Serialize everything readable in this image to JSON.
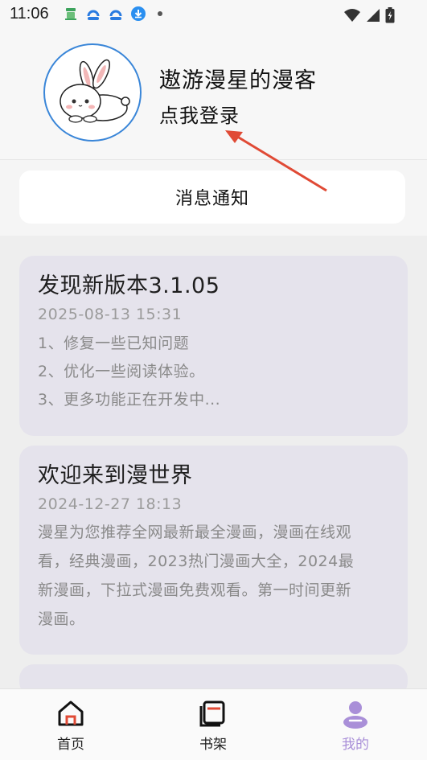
{
  "status_bar": {
    "time": "11:06",
    "icons": [
      "app-notify-icon",
      "cloud-icon",
      "cloud-icon",
      "download-icon",
      "dot-icon",
      "wifi-icon",
      "signal-icon",
      "battery-icon"
    ]
  },
  "profile": {
    "username": "遨游漫星的漫客",
    "login_label": "点我登录"
  },
  "notice_button": "消息通知",
  "notices": [
    {
      "title": "发现新版本3.1.05",
      "date": "2025-08-13 15:31",
      "lines": [
        "1、修复一些已知问题",
        "2、优化一些阅读体验。",
        "3、更多功能正在开发中..."
      ]
    },
    {
      "title": "欢迎来到漫世界",
      "date": "2024-12-27 18:13",
      "body_lines": [
        "漫星为您推荐全网最新最全漫画，漫画在线观",
        "看，经典漫画，2023热门漫画大全，2024最",
        "新漫画，下拉式漫画免费观看。第一时间更新",
        "漫画。"
      ]
    }
  ],
  "bottom_nav": [
    {
      "label": "首页",
      "icon": "home-icon",
      "active": false
    },
    {
      "label": "书架",
      "icon": "bookshelf-icon",
      "active": false
    },
    {
      "label": "我的",
      "icon": "profile-icon",
      "active": true
    }
  ],
  "colors": {
    "accent": "#a98fd8",
    "card_bg": "#e5e3ec",
    "avatar_border": "#3a86d8",
    "annotation_arrow": "#e04a35"
  }
}
